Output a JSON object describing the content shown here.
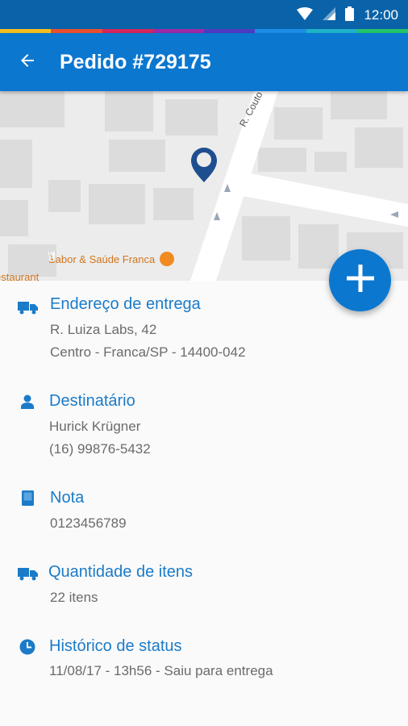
{
  "status_bar": {
    "time": "12:00",
    "icons": [
      "wifi-icon",
      "signal-icon",
      "battery-icon"
    ],
    "rainbow_colors": [
      "#f4c020",
      "#e8502f",
      "#d3265c",
      "#9c2aa6",
      "#4f3bc2",
      "#1e8fe6",
      "#1fb3c9",
      "#23c46a"
    ]
  },
  "app_bar": {
    "title": "Pedido #729175",
    "back_icon": "arrow-back-icon"
  },
  "map": {
    "poi_label": "Sabor & Saúde Franca",
    "restaurant_label": "estaurant",
    "street_label": "R. Couto Ma",
    "pin_icon": "location-pin-icon",
    "poi_icon": "fork-knife-icon"
  },
  "fab": {
    "icon": "plus-icon"
  },
  "sections": {
    "address": {
      "title": "Endereço de entrega",
      "icon": "truck-icon",
      "line1": "R. Luiza Labs, 42",
      "line2": "Centro - Franca/SP - 14400-042"
    },
    "recipient": {
      "title": "Destinatário",
      "icon": "person-icon",
      "line1": "Hurick Krügner",
      "line2": "(16) 99876-5432"
    },
    "note": {
      "title": "Nota",
      "icon": "book-icon",
      "line1": "0123456789"
    },
    "quantity": {
      "title": "Quantidade de itens",
      "icon": "truck-icon",
      "line1": "22 itens"
    },
    "history": {
      "title": "Histórico de status",
      "icon": "clock-icon",
      "line1": "11/08/17 - 13h56 - Saiu para entrega"
    }
  },
  "colors": {
    "status_bar": "#0a63a8",
    "app_bar": "#0b77cf",
    "accent": "#1b7bc8",
    "secondary_text": "#6b6b6b",
    "poi_text": "#d1751c"
  }
}
